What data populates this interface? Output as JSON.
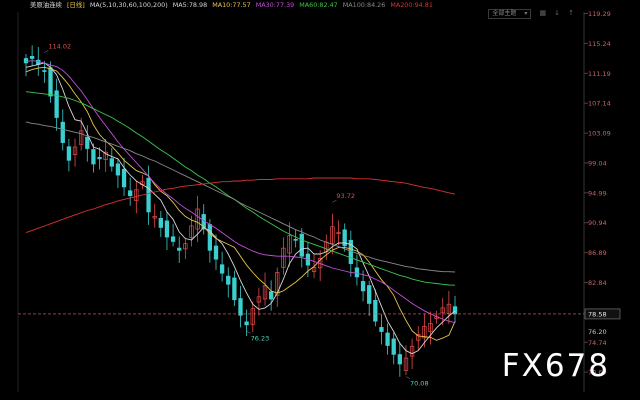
{
  "header": {
    "symbol": "美原油连续",
    "period": "[日线]",
    "ma_params": "MA(5,10,30,60,100,200)",
    "ma_values": [
      {
        "label": "MA5:78.98",
        "color": "#d8d8d8"
      },
      {
        "label": "MA10:77.57",
        "color": "#e8c64a"
      },
      {
        "label": "MA30:77.39",
        "color": "#c450d8"
      },
      {
        "label": "MA60:82.47",
        "color": "#3cc84a"
      },
      {
        "label": "MA100:84.26",
        "color": "#8a8a8a"
      },
      {
        "label": "MA200:94.81",
        "color": "#d83232"
      }
    ]
  },
  "toolbar": {
    "dropdown_label": "全部主题",
    "icons": [
      "grid-icon",
      "arrow-down-icon",
      "arrow-up-icon"
    ]
  },
  "watermark": "FX678",
  "chart_data": {
    "type": "candlestick",
    "ylim": [
      68.0,
      119.5
    ],
    "y_ticks": [
      "119.29",
      "115.24",
      "111.19",
      "107.14",
      "103.09",
      "99.04",
      "94.99",
      "90.94",
      "86.89",
      "82.84",
      "78.79",
      "74.74",
      "70.69"
    ],
    "last_price": "78.58",
    "last_price_color": "#e46a6a",
    "right_labels": [
      {
        "text": "76.20",
        "value": 76.2
      }
    ],
    "annotations": [
      {
        "text": "114.02",
        "value": 114.02,
        "index": 3,
        "color": "#e84a4a",
        "pos": "high"
      },
      {
        "text": "93.72",
        "value": 93.72,
        "index": 50,
        "color": "#e84a4a",
        "pos": "high"
      },
      {
        "text": "76.23",
        "value": 76.23,
        "index": 36,
        "color": "#46d8c0",
        "pos": "low"
      },
      {
        "text": "70.08",
        "value": 70.08,
        "index": 62,
        "color": "#46d8c0",
        "pos": "low"
      }
    ],
    "up_color": "#e84a4a",
    "down_color": "#3ccfd0",
    "closes": [
      112.6,
      113.2,
      112.4,
      111.5,
      108.1,
      105.2,
      101.8,
      99.4,
      101.2,
      103.4,
      101.0,
      98.9,
      99.6,
      100.5,
      98.6,
      97.4,
      95.8,
      94.6,
      95.4,
      96.5,
      92.4,
      91.8,
      90.3,
      89.0,
      88.4,
      87.2,
      88.1,
      90.5,
      92.8,
      90.1,
      87.2,
      86.0,
      84.1,
      82.6,
      80.5,
      78.4,
      77.1,
      79.3,
      80.9,
      82.4,
      80.6,
      84.2,
      87.5,
      89.2,
      88.6,
      86.4,
      85.2,
      84.9,
      86.1,
      88.3,
      90.4,
      89.6,
      87.8,
      85.4,
      83.6,
      81.7,
      80.0,
      77.6,
      76.2,
      74.3,
      73.1,
      71.8,
      72.6,
      74.2,
      75.8,
      76.9,
      77.3,
      78.2,
      79.4,
      79.9,
      78.58
    ],
    "ma_series": [
      {
        "name": "MA5",
        "color": "#d8d8d8",
        "values": [
          112.0,
          112.2,
          112.4,
          112.6,
          112.0,
          111.0,
          109.0,
          106.7,
          104.9,
          104.7,
          103.0,
          101.2,
          100.9,
          100.3,
          99.9,
          99.6,
          98.4,
          97.4,
          96.6,
          96.1,
          95.6,
          94.8,
          94.0,
          92.4,
          91.4,
          89.7,
          88.8,
          88.6,
          89.4,
          90.3,
          89.8,
          88.9,
          88.1,
          86.7,
          85.0,
          83.1,
          81.4,
          79.9,
          79.2,
          79.4,
          80.0,
          81.4,
          83.3,
          85.4,
          86.7,
          87.4,
          87.5,
          86.7,
          86.7,
          87.0,
          87.7,
          88.2,
          88.2,
          88.0,
          87.4,
          85.5,
          83.7,
          81.7,
          79.6,
          77.6,
          76.2,
          74.6,
          73.6,
          73.2,
          73.6,
          74.7,
          75.7,
          76.7,
          77.5,
          78.3,
          78.98
        ]
      },
      {
        "name": "MA10",
        "color": "#e8c64a",
        "values": [
          111.4,
          111.7,
          111.9,
          112.0,
          111.8,
          111.5,
          110.6,
          109.6,
          108.4,
          107.3,
          106.0,
          104.2,
          102.9,
          102.0,
          101.3,
          100.4,
          99.4,
          98.7,
          98.0,
          97.7,
          97.3,
          96.1,
          95.2,
          94.6,
          93.7,
          92.6,
          91.8,
          91.3,
          91.0,
          90.4,
          89.5,
          88.8,
          88.4,
          88.0,
          87.6,
          86.4,
          85.2,
          84.2,
          83.3,
          82.6,
          81.7,
          81.4,
          81.7,
          82.3,
          82.9,
          83.6,
          84.4,
          85.0,
          85.9,
          86.6,
          87.2,
          87.6,
          87.6,
          87.4,
          87.1,
          86.6,
          85.6,
          84.4,
          83.2,
          82.3,
          81.1,
          79.3,
          77.7,
          76.3,
          75.6,
          75.5,
          75.4,
          75.0,
          75.3,
          75.7,
          77.57
        ]
      },
      {
        "name": "MA30",
        "color": "#c450d8",
        "values": [
          112.8,
          112.9,
          112.8,
          112.6,
          112.3,
          112.1,
          111.6,
          110.8,
          109.8,
          108.8,
          107.6,
          106.4,
          105.2,
          104.1,
          103.0,
          101.9,
          100.9,
          100.0,
          99.1,
          98.2,
          97.2,
          96.3,
          95.5,
          94.8,
          94.2,
          93.5,
          92.9,
          92.4,
          91.8,
          91.2,
          90.7,
          90.2,
          89.6,
          89.0,
          88.4,
          87.9,
          87.5,
          87.1,
          86.8,
          86.6,
          86.5,
          86.4,
          86.4,
          86.4,
          86.3,
          86.2,
          86.0,
          85.7,
          85.4,
          85.1,
          84.8,
          84.6,
          84.4,
          84.2,
          84.1,
          83.9,
          83.7,
          83.3,
          82.9,
          82.4,
          81.8,
          81.2,
          80.6,
          80.0,
          79.5,
          79.0,
          78.6,
          78.2,
          77.9,
          77.6,
          77.39
        ]
      },
      {
        "name": "MA60",
        "color": "#3cc84a",
        "values": [
          108.7,
          108.6,
          108.5,
          108.4,
          108.3,
          108.2,
          108.0,
          107.8,
          107.5,
          107.2,
          106.8,
          106.4,
          106.0,
          105.6,
          105.2,
          104.7,
          104.2,
          103.7,
          103.1,
          102.6,
          102.0,
          101.4,
          100.8,
          100.3,
          99.7,
          99.1,
          98.5,
          98.0,
          97.4,
          96.9,
          96.3,
          95.8,
          95.2,
          94.6,
          94.1,
          93.5,
          92.9,
          92.4,
          91.8,
          91.3,
          90.8,
          90.3,
          89.8,
          89.4,
          89.0,
          88.6,
          88.3,
          88.0,
          87.7,
          87.4,
          87.1,
          86.8,
          86.5,
          86.2,
          85.9,
          85.6,
          85.3,
          85.0,
          84.7,
          84.4,
          84.1,
          83.8,
          83.6,
          83.3,
          83.1,
          82.9,
          82.8,
          82.7,
          82.6,
          82.5,
          82.47
        ]
      },
      {
        "name": "MA100",
        "color": "#8a8a8a",
        "values": [
          104.6,
          104.4,
          104.3,
          104.1,
          104.0,
          103.8,
          103.6,
          103.4,
          103.2,
          103.0,
          102.7,
          102.5,
          102.2,
          101.9,
          101.6,
          101.3,
          101.0,
          100.7,
          100.3,
          100.0,
          99.6,
          99.3,
          98.9,
          98.5,
          98.1,
          97.7,
          97.3,
          96.9,
          96.5,
          96.1,
          95.7,
          95.3,
          94.9,
          94.5,
          94.1,
          93.6,
          93.2,
          92.8,
          92.4,
          92.0,
          91.6,
          91.2,
          90.8,
          90.4,
          90.0,
          89.7,
          89.3,
          89.0,
          88.6,
          88.3,
          88.0,
          87.7,
          87.4,
          87.1,
          86.8,
          86.5,
          86.3,
          86.0,
          85.8,
          85.6,
          85.4,
          85.2,
          85.0,
          84.9,
          84.7,
          84.6,
          84.5,
          84.4,
          84.3,
          84.3,
          84.26
        ]
      },
      {
        "name": "MA200",
        "color": "#d83232",
        "values": [
          89.6,
          89.9,
          90.2,
          90.5,
          90.8,
          91.1,
          91.4,
          91.7,
          92.0,
          92.3,
          92.6,
          92.8,
          93.1,
          93.4,
          93.6,
          93.9,
          94.1,
          94.3,
          94.5,
          94.7,
          94.9,
          95.1,
          95.3,
          95.5,
          95.6,
          95.8,
          95.9,
          96.0,
          96.1,
          96.2,
          96.3,
          96.4,
          96.5,
          96.5,
          96.6,
          96.6,
          96.7,
          96.7,
          96.8,
          96.8,
          96.8,
          96.9,
          96.9,
          96.9,
          96.9,
          96.9,
          96.9,
          97.0,
          97.0,
          97.0,
          97.0,
          97.0,
          97.0,
          97.0,
          96.9,
          96.9,
          96.9,
          96.8,
          96.7,
          96.6,
          96.5,
          96.4,
          96.3,
          96.1,
          95.9,
          95.7,
          95.6,
          95.4,
          95.2,
          95.0,
          94.81
        ]
      }
    ]
  }
}
